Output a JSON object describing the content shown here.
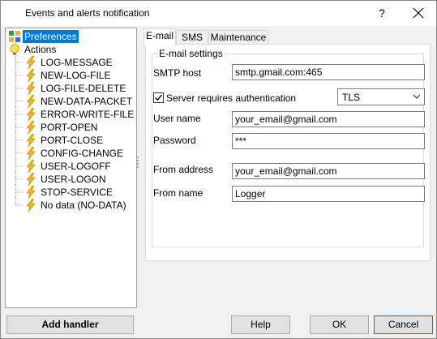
{
  "window": {
    "title": "Events and alerts notification",
    "help_label": "?"
  },
  "tree": {
    "root": "Preferences",
    "actions": "Actions",
    "items": [
      "LOG-MESSAGE",
      "NEW-LOG-FILE",
      "LOG-FILE-DELETE",
      "NEW-DATA-PACKET",
      "ERROR-WRITE-FILE",
      "PORT-OPEN",
      "PORT-CLOSE",
      "CONFIG-CHANGE",
      "USER-LOGOFF",
      "USER-LOGON",
      "STOP-SERVICE",
      "No data (NO-DATA)"
    ]
  },
  "tabs": [
    "E-mail",
    "SMS",
    "Maintenance"
  ],
  "email": {
    "group_title": "E-mail settings",
    "smtp_label": "SMTP host",
    "smtp_value": "smtp.gmail.com:465",
    "auth_label": "Server requires authentication",
    "auth_checked": true,
    "security_value": "TLS",
    "user_label": "User name",
    "user_value": "your_email@gmail.com",
    "password_label": "Password",
    "password_value": "***",
    "from_address_label": "From address",
    "from_address_value": "your_email@gmail.com",
    "from_name_label": "From name",
    "from_name_value": "Logger"
  },
  "buttons": {
    "add_handler": "Add handler",
    "help": "Help",
    "ok": "OK",
    "cancel": "Cancel"
  }
}
